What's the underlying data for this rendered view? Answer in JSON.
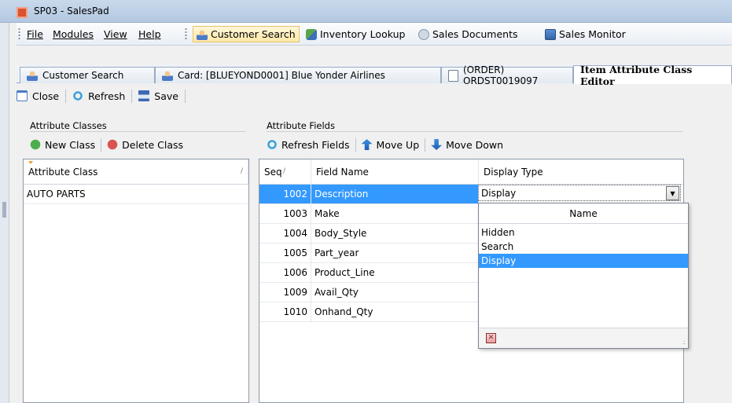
{
  "window": {
    "title": "SP03 - SalesPad"
  },
  "menu": [
    {
      "label": "File",
      "mnemonic": "F"
    },
    {
      "label": "Modules",
      "mnemonic": "M"
    },
    {
      "label": "View",
      "mnemonic": "V"
    },
    {
      "label": "Help",
      "mnemonic": "H"
    }
  ],
  "quick_toolbar": [
    {
      "label": "Customer Search",
      "icon": "customer-icon"
    },
    {
      "label": "Inventory Lookup",
      "icon": "inventory-icon"
    },
    {
      "label": "Sales Documents",
      "icon": "documents-icon"
    },
    {
      "label": "Sales Monitor",
      "icon": "monitor-icon"
    }
  ],
  "tabs": [
    {
      "label": "Customer Search",
      "icon": "customer-icon"
    },
    {
      "label": "Card: [BLUEYOND0001] Blue Yonder Airlines",
      "icon": "customer-icon"
    },
    {
      "label": "(ORDER) ORDST0019097",
      "icon": "document-icon"
    },
    {
      "label": "Item Attribute Class Editor",
      "active": true
    }
  ],
  "page_toolbar": {
    "close": "Close",
    "refresh": "Refresh",
    "save": "Save"
  },
  "attribute_classes": {
    "group_label": "Attribute Classes",
    "new_class": "New Class",
    "delete_class": "Delete Class",
    "column_header": "Attribute Class",
    "rows": [
      "AUTO PARTS"
    ]
  },
  "attribute_fields": {
    "group_label": "Attribute Fields",
    "refresh_fields": "Refresh Fields",
    "move_up": "Move Up",
    "move_down": "Move Down",
    "columns": {
      "seq": "Seq",
      "field_name": "Field Name",
      "display_type": "Display Type"
    },
    "rows": [
      {
        "seq": "1002",
        "field_name": "Description",
        "display_type": "Display",
        "selected": true
      },
      {
        "seq": "1003",
        "field_name": "Make",
        "display_type": ""
      },
      {
        "seq": "1004",
        "field_name": "Body_Style",
        "display_type": ""
      },
      {
        "seq": "1005",
        "field_name": "Part_year",
        "display_type": ""
      },
      {
        "seq": "1006",
        "field_name": "Product_Line",
        "display_type": ""
      },
      {
        "seq": "1009",
        "field_name": "Avail_Qty",
        "display_type": ""
      },
      {
        "seq": "1010",
        "field_name": "Onhand_Qty",
        "display_type": ""
      }
    ]
  },
  "display_type_dropdown": {
    "current": "Display",
    "header": "Name",
    "options": [
      "Hidden",
      "Search",
      "Display"
    ],
    "selected_option": "Display"
  },
  "colors": {
    "selection": "#3399ff",
    "accent": "#d9532c"
  }
}
